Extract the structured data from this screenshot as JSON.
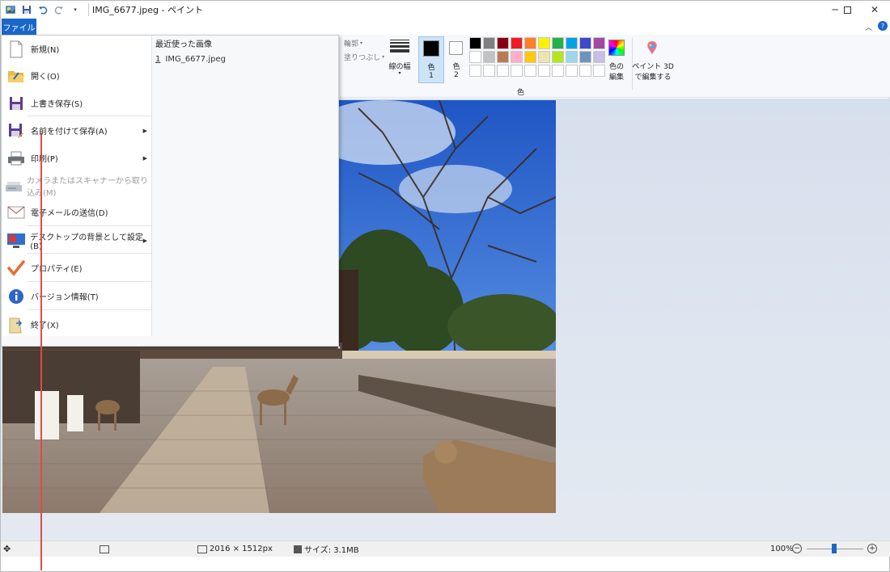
{
  "window": {
    "title": "IMG_6677.jpeg - ペイント",
    "controls": [
      "minimize",
      "maximize",
      "close"
    ]
  },
  "menubar": {
    "file_tab": "ファイル"
  },
  "ribbon": {
    "outline_label": "輪郭",
    "fill_label": "塗りつぶし",
    "size_label": "線の幅",
    "color1_label": "色",
    "color1_num": "1",
    "color2_label": "色",
    "color2_num": "2",
    "edit_colors_line1": "色の",
    "edit_colors_line2": "編集",
    "paint3d_line1": "ペイント 3D",
    "paint3d_line2": "で編集する",
    "colors_group": "色",
    "palette_row1": [
      "#000000",
      "#7f7f7f",
      "#880015",
      "#ed1c24",
      "#ff7f27",
      "#fff200",
      "#22b14c",
      "#00a2e8",
      "#3f48cc",
      "#a349a4"
    ],
    "palette_row2": [
      "#ffffff",
      "#c3c3c3",
      "#b97a57",
      "#ffaec9",
      "#ffc90e",
      "#efe4b0",
      "#b5e61d",
      "#99d9ea",
      "#7092be",
      "#c8bfe7"
    ],
    "palette_row3_count": 10
  },
  "file_menu": {
    "items": [
      {
        "label": "新規(N)",
        "icon": "new-file-icon",
        "arrow": false,
        "disabled": false
      },
      {
        "label": "開く(O)",
        "icon": "open-folder-icon",
        "arrow": false,
        "disabled": false
      },
      {
        "label": "上書き保存(S)",
        "icon": "save-icon",
        "arrow": false,
        "disabled": false
      },
      {
        "label": "名前を付けて保存(A)",
        "icon": "save-as-icon",
        "arrow": true,
        "disabled": false
      },
      {
        "label": "印刷(P)",
        "icon": "printer-icon",
        "arrow": true,
        "disabled": false
      },
      {
        "label": "カメラまたはスキャナーから取り込み(M)",
        "icon": "scanner-icon",
        "arrow": false,
        "disabled": true
      },
      {
        "label": "電子メールの送信(D)",
        "icon": "email-icon",
        "arrow": false,
        "disabled": false
      },
      {
        "label": "デスクトップの背景として設定(B)",
        "icon": "desktop-background-icon",
        "arrow": true,
        "disabled": false
      },
      {
        "label": "プロパティ(E)",
        "icon": "checkmark-icon",
        "arrow": false,
        "disabled": false
      },
      {
        "label": "バージョン情報(T)",
        "icon": "info-icon",
        "arrow": false,
        "disabled": false
      },
      {
        "label": "終了(X)",
        "icon": "exit-icon",
        "arrow": false,
        "disabled": false
      }
    ],
    "recent_title": "最近使った画像",
    "recent": [
      {
        "num": "1",
        "name": "IMG_6677.jpeg"
      }
    ]
  },
  "statusbar": {
    "dimensions": "2016 × 1512px",
    "size": "サイズ: 3.1MB",
    "zoom": "100%"
  }
}
